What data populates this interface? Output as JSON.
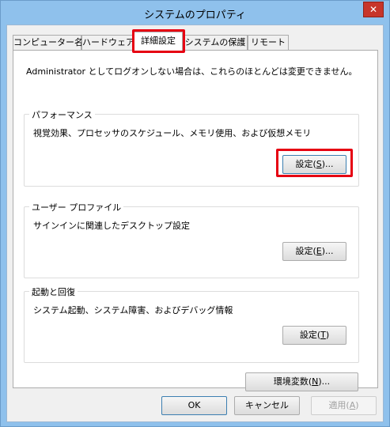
{
  "window": {
    "title": "システムのプロパティ",
    "close_glyph": "✕"
  },
  "tabs": [
    {
      "label": "コンピューター名"
    },
    {
      "label": "ハードウェア"
    },
    {
      "label": "詳細設定"
    },
    {
      "label": "システムの保護"
    },
    {
      "label": "リモート"
    }
  ],
  "intro": "Administrator としてログオンしない場合は、これらのほとんどは変更できません。",
  "performance": {
    "label": "パフォーマンス",
    "desc": "視覚効果、プロセッサのスケジュール、メモリ使用、および仮想メモリ",
    "btn_pre": "設定(",
    "btn_key": "S",
    "btn_post": ")..."
  },
  "user_profile": {
    "label": "ユーザー プロファイル",
    "desc": "サインインに関連したデスクトップ設定",
    "btn_pre": "設定(",
    "btn_key": "E",
    "btn_post": ")..."
  },
  "startup": {
    "label": "起動と回復",
    "desc": "システム起動、システム障害、およびデバッグ情報",
    "btn_pre": "設定(",
    "btn_key": "T",
    "btn_post": ")"
  },
  "env": {
    "btn_pre": "環境変数(",
    "btn_key": "N",
    "btn_post": ")..."
  },
  "footer": {
    "ok": "OK",
    "cancel": "キャンセル",
    "apply_pre": "適用(",
    "apply_key": "A",
    "apply_post": ")"
  },
  "colors": {
    "highlight": "#e60012",
    "close_bg": "#c7352a",
    "frame": "#8fc1ec"
  }
}
